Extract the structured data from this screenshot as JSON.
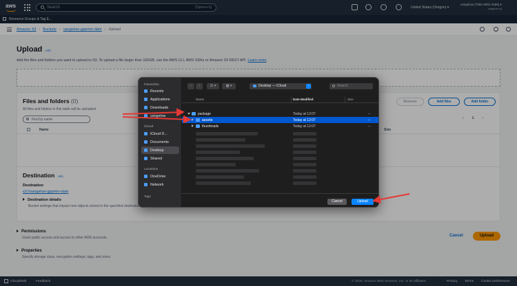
{
  "topnav": {
    "logo": "aws",
    "search_placeholder": "Search",
    "search_shortcut": "[Option+S]",
    "region": "United States (Oregon) ▾",
    "account": "vangelow (7650-3091-4466) ▾",
    "account_sub": "vanglow+oj",
    "icons": [
      "apps-grid-icon",
      "cloudshell-icon",
      "bell-icon",
      "help-icon",
      "settings-icon"
    ]
  },
  "favbar": {
    "label": "Resource Groups & Tag E..."
  },
  "breadcrumb": {
    "items": [
      "Amazon S3",
      "Buckets",
      "vangelow-gppmm-dam"
    ],
    "current": "Upload"
  },
  "page": {
    "title": "Upload",
    "info": "Info",
    "description": "Add the files and folders you want to upload to S3. To upload a file larger than 160GB, use the AWS CLI, AWS SDKs or Amazon S3 REST API.",
    "learn_more": "Learn more",
    "files": {
      "title": "Files and folders",
      "count": "(0)",
      "subtitle": "All files and folders in this table will be uploaded.",
      "remove": "Remove",
      "add_files": "Add files",
      "add_folder": "Add folder",
      "filter_placeholder": "Find by name",
      "page_num": "1",
      "col_name": "Name",
      "col_size": "Size"
    },
    "destination": {
      "title": "Destination",
      "info": "Info",
      "label": "Destination",
      "link": "s3://vangelow-gppmm-dam",
      "details": "Destination details",
      "details_sub": "Bucket settings that impact new objects stored in the specified destination."
    },
    "permissions": {
      "title": "Permissions",
      "sub": "Grant public access and access to other AWS accounts."
    },
    "properties": {
      "title": "Properties",
      "sub": "Specify storage class, encryption settings, tags, and more."
    },
    "cancel": "Cancel",
    "upload": "Upload"
  },
  "footer": {
    "cloudshell": "CloudShell",
    "feedback": "Feedback",
    "copyright": "© 2025, Amazon Web Services, Inc. or its affiliates.",
    "privacy": "Privacy",
    "terms": "Terms",
    "cookie": "Cookie preferences"
  },
  "dialog": {
    "sidebar": {
      "favourites": "Favourites",
      "recents": "Recents",
      "applications": "Applications",
      "downloads": "Downloads",
      "user": "vangelow",
      "icloud": "iCloud",
      "icloud_drive": "iCloud D...",
      "documents": "Documents",
      "desktop": "Desktop",
      "shared": "Shared",
      "locations": "Locations",
      "onedrive": "OneDrive",
      "network": "Network",
      "tags": "Tags"
    },
    "toolbar": {
      "back": "‹",
      "forward": "›",
      "view_list": "☰ ▾",
      "view_grid": "▦ ▾",
      "location": "Desktop — iCloud",
      "search_placeholder": "Search"
    },
    "columns": {
      "name": "Name",
      "date": "Date Modified",
      "size": "Size"
    },
    "rows": [
      {
        "name": "package",
        "date": "Today at 12:07",
        "size": "--"
      },
      {
        "name": "assets",
        "date": "Today at 12:07",
        "size": "--"
      },
      {
        "name": "thumbnails",
        "date": "Today at 12:07",
        "size": "--"
      }
    ],
    "cancel": "Cancel",
    "upload": "Upload"
  },
  "colors": {
    "nav": "#232f3e",
    "link": "#0972d3",
    "accent_orange": "#ff9900",
    "mac_selection": "#0058d0",
    "mac_button": "#0a84ff",
    "annotation_arrow": "#e53935"
  }
}
